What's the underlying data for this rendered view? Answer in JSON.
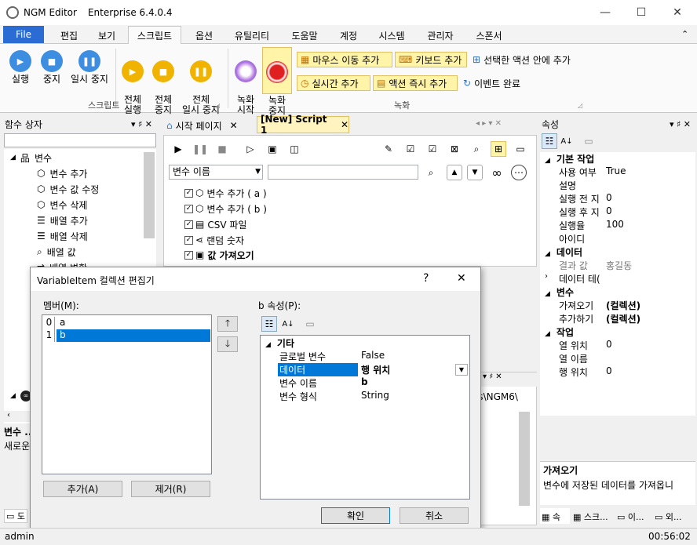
{
  "window": {
    "app": "NGM Editor",
    "edition": "Enterprise 6.4.0.4",
    "minimize": "—",
    "maximize": "☐",
    "close": "✕"
  },
  "menu": {
    "file": "File",
    "items": [
      "편집",
      "보기",
      "스크립트",
      "옵션",
      "유틸리티",
      "도움말",
      "계정",
      "시스템",
      "관리자",
      "스폰서"
    ]
  },
  "ribbon": {
    "run": "실행",
    "stop": "중지",
    "pause": "일시 중지",
    "all_run": "전체\n실행",
    "all_stop": "전체\n중지",
    "all_pause": "전체\n일시 중지",
    "script_group": "스크립트",
    "rec_start": "녹화\n시작",
    "rec_stop": "녹화\n중지",
    "mouse_move": "마우스 이동 추가",
    "keyboard": "키보드 추가",
    "in_selected": "선택한 액션 안에 추가",
    "realtime": "실시간 추가",
    "instant": "액션 즉시 추가",
    "event_done": "이벤트 완료",
    "record_group": "녹화"
  },
  "left_panel": {
    "title": "함수 상자",
    "pin": "▾ ♯ ✕",
    "tree": {
      "root": "변수",
      "items": [
        "변수 추가",
        "변수 값 수정",
        "변수 삭제",
        "배열 추가",
        "배열 삭제",
        "배열 값",
        "배열 변환"
      ]
    },
    "bottom_title": "변수 ...",
    "bottom_desc": "새로운..."
  },
  "tabs": {
    "start": "시작 페이지",
    "script": "[New] Script 1"
  },
  "editor": {
    "search_combo": "변수 이름",
    "search_value": "",
    "actions": [
      "변수 추가 ( a )",
      "변수 추가 ( b )",
      "CSV 파일",
      "랜덤 숫자",
      "값 가져오기"
    ],
    "output_path": "nts\\NGM6\\"
  },
  "props": {
    "title": "속성",
    "cat_basic": "기본 작업",
    "basic": [
      [
        "사용 여부",
        "True"
      ],
      [
        "설명",
        ""
      ],
      [
        "실행 전 지",
        "0"
      ],
      [
        "실행 후 지",
        "0"
      ],
      [
        "실행율",
        "100"
      ],
      [
        "아이디",
        ""
      ]
    ],
    "cat_data": "데이터",
    "data": [
      [
        "결과 값",
        "홍길동"
      ],
      [
        "데이터 테(",
        ""
      ]
    ],
    "cat_var": "변수",
    "var": [
      [
        "가져오기",
        "(컬렉션)"
      ],
      [
        "추가하기",
        "(컬렉션)"
      ]
    ],
    "cat_work": "작업",
    "work": [
      [
        "열 위치",
        "0"
      ],
      [
        "열 이름",
        ""
      ],
      [
        "행 위치",
        "0"
      ]
    ],
    "desc_title": "가져오기",
    "desc_text": "변수에 저장된 데이터를 가져옵니",
    "bottom_tabs": [
      "속",
      "스크...",
      "이...",
      "외..."
    ]
  },
  "dialog": {
    "title": "VariableItem 컬렉션 편집기",
    "help": "?",
    "close": "✕",
    "members_label": "멤버(M):",
    "members": [
      [
        "0",
        "a"
      ],
      [
        "1",
        "b"
      ]
    ],
    "props_label": "b 속성(P):",
    "cat": "기타",
    "rows": [
      [
        "글로벌 변수",
        "False"
      ],
      [
        "데이터",
        "행 위치"
      ],
      [
        "변수 이름",
        "b"
      ],
      [
        "변수 형식",
        "String"
      ]
    ],
    "add": "추가(A)",
    "remove": "제거(R)",
    "ok": "확인",
    "cancel": "취소"
  },
  "status": {
    "user": "admin",
    "time": "00:56:02"
  }
}
